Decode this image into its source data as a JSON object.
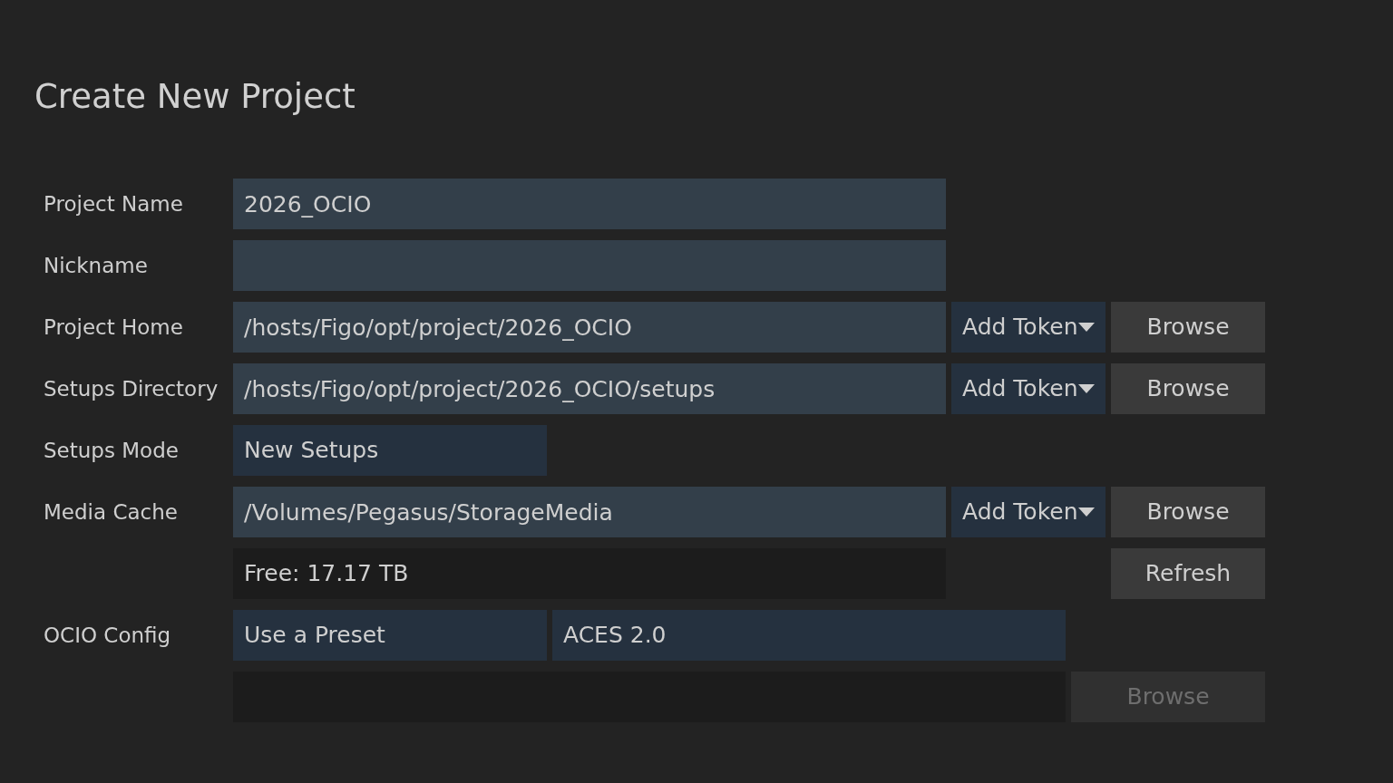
{
  "title": "Create New Project",
  "rows": [
    {
      "label": "Project Name",
      "controls": [
        {
          "kind": "field",
          "value": "2026_OCIO"
        }
      ]
    },
    {
      "label": "Nickname",
      "controls": [
        {
          "kind": "field"
        }
      ]
    },
    {
      "label": "Project Home",
      "controls": [
        {
          "kind": "field",
          "value": "/hosts/Figo/opt/project/2026_OCIO"
        },
        {
          "kind": "token",
          "label": "Add Token"
        },
        {
          "kind": "button",
          "label": "Browse",
          "disabled": false
        }
      ]
    },
    {
      "label": "Setups Directory",
      "controls": [
        {
          "kind": "field",
          "value": "/hosts/Figo/opt/project/2026_OCIO/setups"
        },
        {
          "kind": "token",
          "label": "Add Token"
        },
        {
          "kind": "button",
          "label": "Browse",
          "disabled": false
        }
      ]
    },
    {
      "label": "Setups Mode",
      "controls": [
        {
          "kind": "select",
          "value": "New Setups"
        }
      ]
    },
    {
      "label": "Media Cache",
      "controls": [
        {
          "kind": "field",
          "value": "/Volumes/Pegasus/StorageMedia"
        },
        {
          "kind": "token",
          "label": "Add Token"
        },
        {
          "kind": "button",
          "label": "Browse",
          "disabled": false
        }
      ]
    },
    {
      "controls": [
        {
          "kind": "info",
          "value": "Free: 17.17 TB"
        },
        {
          "kind": "button",
          "label": "Refresh",
          "disabled": false
        }
      ]
    },
    {
      "label": "OCIO Config",
      "controls": [
        {
          "kind": "select",
          "value": "Use a Preset"
        },
        {
          "kind": "wideselect",
          "value": "ACES 2.0"
        }
      ]
    },
    {
      "controls": [
        {
          "kind": "pathbox"
        },
        {
          "kind": "widebutton",
          "label": "Browse",
          "disabled": true
        }
      ]
    }
  ]
}
